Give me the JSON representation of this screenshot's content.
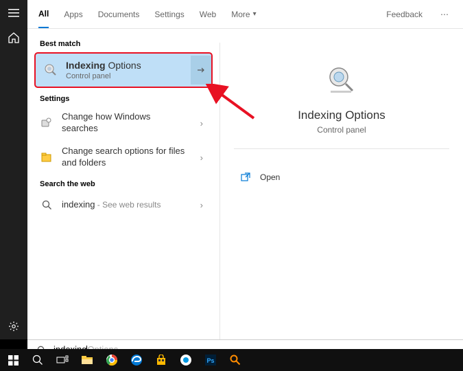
{
  "sidebar": {},
  "tabs": {
    "items": [
      "All",
      "Apps",
      "Documents",
      "Settings",
      "Web",
      "More"
    ],
    "feedback": "Feedback"
  },
  "results": {
    "best_match_label": "Best match",
    "best_match": {
      "title_bold": "Indexing",
      "title_rest": " Options",
      "subtitle": "Control panel"
    },
    "settings_label": "Settings",
    "settings_items": [
      {
        "label": "Change how Windows searches"
      },
      {
        "label": "Change search options for files and folders"
      }
    ],
    "web_label": "Search the web",
    "web_item": {
      "term": "indexing",
      "suffix": " - See web results"
    }
  },
  "preview": {
    "title": "Indexing Options",
    "subtitle": "Control panel",
    "open_label": "Open"
  },
  "search": {
    "typed": "indexing",
    "suggestion": "Options"
  }
}
